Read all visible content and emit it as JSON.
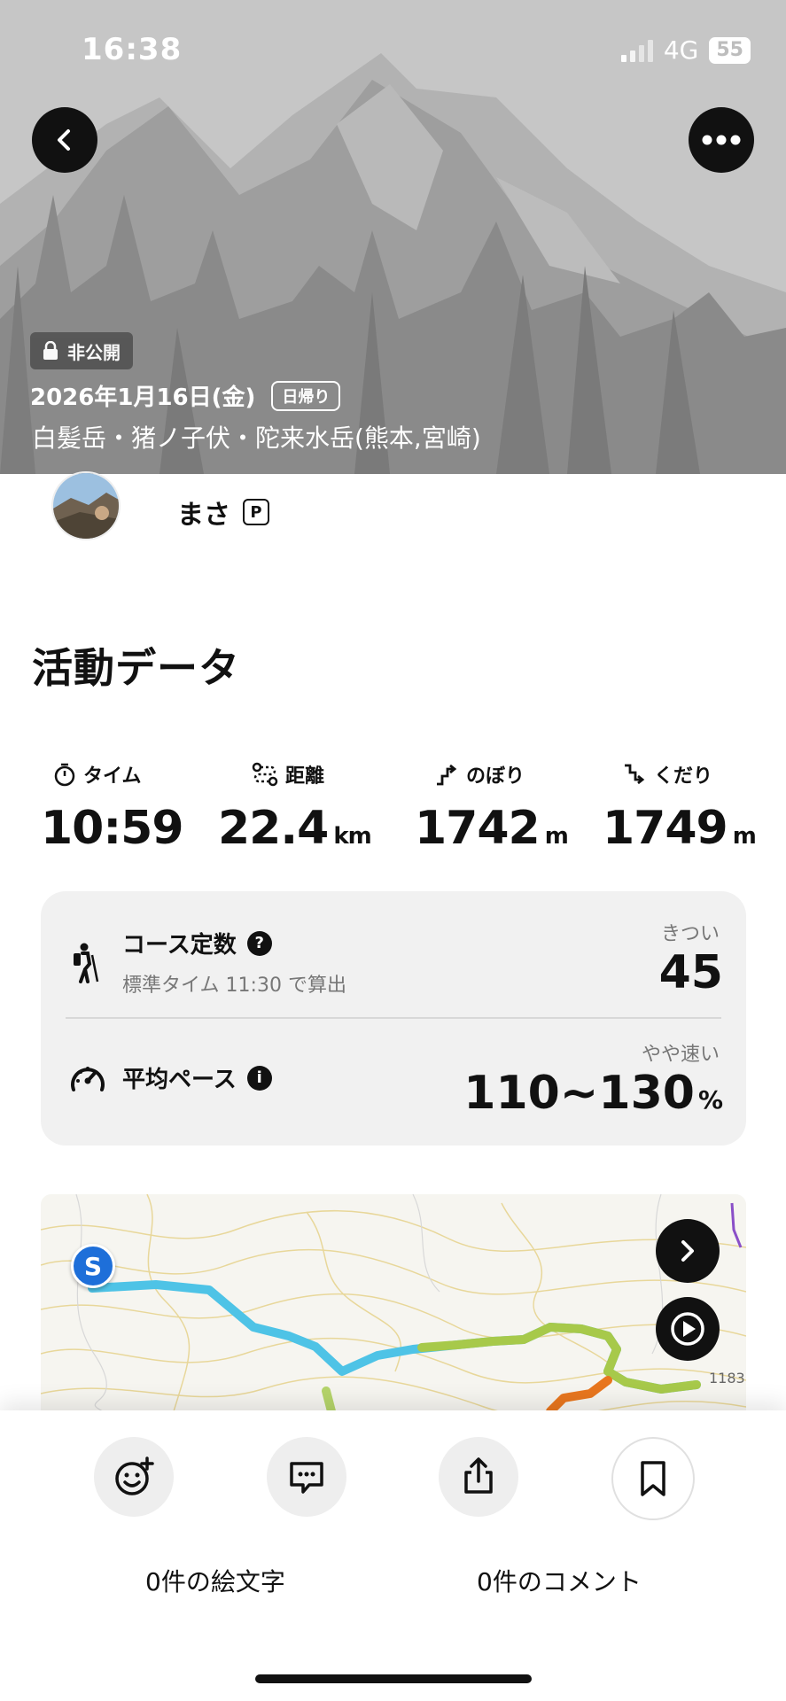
{
  "status_bar": {
    "time": "16:38",
    "network": "4G",
    "battery": "55"
  },
  "header": {
    "private_label": "非公開",
    "date": "2026年1月16日(金)",
    "trip_type": "日帰り",
    "mountains": "白髪岳・猪ノ子伏・陀来水岳(熊本,宮崎)"
  },
  "user": {
    "name": "まさ",
    "badge": "P"
  },
  "section_title": "活動データ",
  "stats": [
    {
      "icon": "stopwatch-icon",
      "label": "タイム",
      "value": "10:59",
      "unit": ""
    },
    {
      "icon": "route-icon",
      "label": "距離",
      "value": "22.4",
      "unit": "km"
    },
    {
      "icon": "ascent-icon",
      "label": "のぼり",
      "value": "1742",
      "unit": "m"
    },
    {
      "icon": "descent-icon",
      "label": "くだり",
      "value": "1749",
      "unit": "m"
    }
  ],
  "course": {
    "title": "コース定数",
    "sub": "標準タイム 11:30 で算出",
    "rating": "きつい",
    "value": "45"
  },
  "pace": {
    "title": "平均ペース",
    "rating": "やや速い",
    "value": "110~130",
    "unit": "%"
  },
  "map": {
    "label_partial": "1183",
    "start_marker": "S"
  },
  "actions": {
    "emoji_count": "0件の絵文字",
    "comment_count": "0件のコメント"
  },
  "colors": {
    "accent_blue": "#1e6fd9",
    "track_start": "#4ec3e6",
    "track_mid": "#a7c94a",
    "track_end": "#e8761e"
  }
}
